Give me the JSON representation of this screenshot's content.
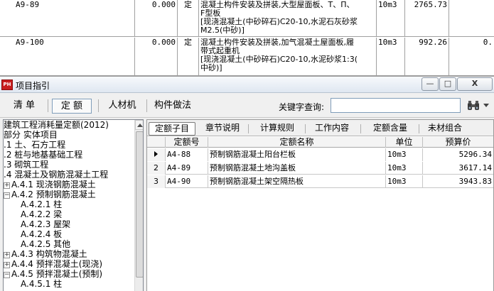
{
  "background_table": {
    "rows": [
      {
        "code": "A9-89",
        "value": "0.000",
        "flag": "定",
        "lines": [
          "混凝土构件安装及拼装,大型屋面板、T、Π、",
          "F型板",
          "[现浇混凝土(中砂碎石)C20-10,水泥石灰砂浆",
          "M2.5(中砂)]"
        ],
        "unit": "10m3",
        "price": "2765.73"
      },
      {
        "code": "A9-100",
        "value": "0.000",
        "flag": "定",
        "lines": [
          "混凝土构件安装及拼装,加气混凝土屋面板,履",
          "带式起重机",
          "[现浇混凝土(中砂碎石)C20-10,水泥砂浆1:3(",
          "中砂)]"
        ],
        "unit": "10m3",
        "price": "992.26",
        "extra": "0."
      }
    ]
  },
  "dialog": {
    "title": "项目指引",
    "app_icon_text": "PH",
    "window_controls": {
      "minimize": "—",
      "maximize": "□",
      "close": "X"
    },
    "toolbar": {
      "tabs": [
        {
          "label": "清  单",
          "active": false
        },
        {
          "label": "定  额",
          "active": true
        },
        {
          "label": "人材机",
          "active": false
        },
        {
          "label": "构件做法",
          "active": false
        }
      ],
      "search_label": "关键字查询:",
      "search_value": ""
    },
    "tree": {
      "items": [
        {
          "text": "建筑工程消耗量定额(2012)",
          "expander": ""
        },
        {
          "text": "部分 实体项目",
          "expander": ""
        },
        {
          "text": ".1 土、石方工程",
          "expander": ""
        },
        {
          "text": ".2 桩与地基基础工程",
          "expander": ""
        },
        {
          "text": ".3 砌筑工程",
          "expander": ""
        },
        {
          "text": ".4 混凝土及钢筋混凝土工程",
          "expander": ""
        },
        {
          "text": "A.4.1 现浇钢筋混凝土",
          "expander": "+"
        },
        {
          "text": "A.4.2 预制钢筋混凝土",
          "expander": "−"
        },
        {
          "text": "A.4.2.1 柱",
          "expander": ""
        },
        {
          "text": "A.4.2.2 梁",
          "expander": ""
        },
        {
          "text": "A.4.2.3 屋架",
          "expander": ""
        },
        {
          "text": "A.4.2.4 板",
          "expander": ""
        },
        {
          "text": "A.4.2.5 其他",
          "expander": ""
        },
        {
          "text": "A.4.3 构筑物混凝土",
          "expander": "+"
        },
        {
          "text": "A.4.4 预拌混凝土(现浇)",
          "expander": "+"
        },
        {
          "text": "A.4.5 预拌混凝土(预制)",
          "expander": "−"
        },
        {
          "text": "A.4.5.1 柱",
          "expander": ""
        }
      ]
    },
    "right_tabs": [
      {
        "label": "定额子目",
        "active": true
      },
      {
        "label": "章节说明",
        "active": false
      },
      {
        "label": "计算规则",
        "active": false
      },
      {
        "label": "工作内容",
        "active": false
      },
      {
        "label": "定额含量",
        "active": false
      },
      {
        "label": "未材组合",
        "active": false
      }
    ],
    "grid": {
      "headers": [
        "定额号",
        "定额名称",
        "单位",
        "预算价"
      ],
      "rows": [
        {
          "num": "1",
          "code": "A4-88",
          "name": "预制钢筋混凝土阳台栏板",
          "unit": "10m3",
          "price": "5296.34",
          "selected": true
        },
        {
          "num": "2",
          "code": "A4-89",
          "name": "预制钢筋混凝土地沟盖板",
          "unit": "10m3",
          "price": "3617.14",
          "selected": false
        },
        {
          "num": "3",
          "code": "A4-90",
          "name": "预制钢筋混凝土架空隔热板",
          "unit": "10m3",
          "price": "3943.83",
          "selected": false
        }
      ]
    }
  },
  "colors": {
    "title_gradient_top": "#f7f9fc",
    "title_gradient_bottom": "#dfe7f1",
    "app_icon": "#c81e1e",
    "grid_line": "#c8c8c8"
  }
}
